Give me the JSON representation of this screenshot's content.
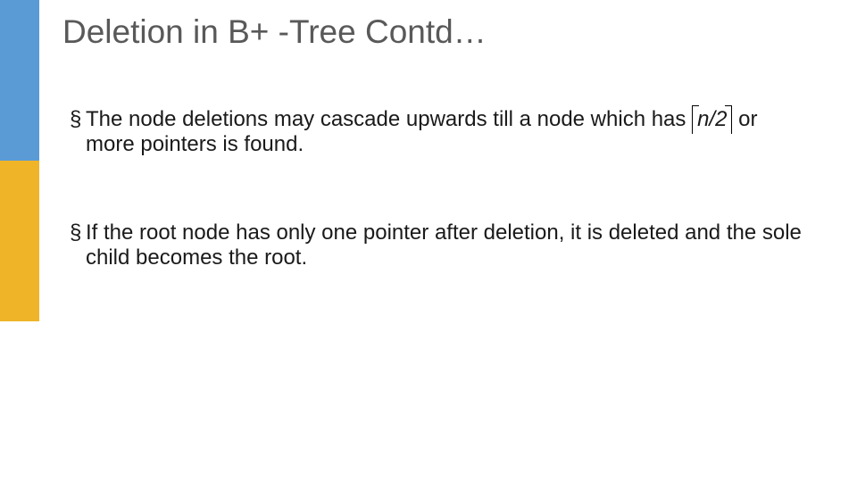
{
  "title": "Deletion in B+ -Tree Contd…",
  "bullets": [
    {
      "pre": "The node deletions may cascade upwards till a node which has ",
      "ceil_expr": "n/2",
      "post": " or more pointers is found."
    },
    {
      "text": "If the root node has only one pointer after deletion, it is deleted and the sole child becomes the root."
    }
  ],
  "colors": {
    "stripe_blue": "#5b9bd5",
    "stripe_yellow": "#f0b428",
    "title": "#595959"
  }
}
